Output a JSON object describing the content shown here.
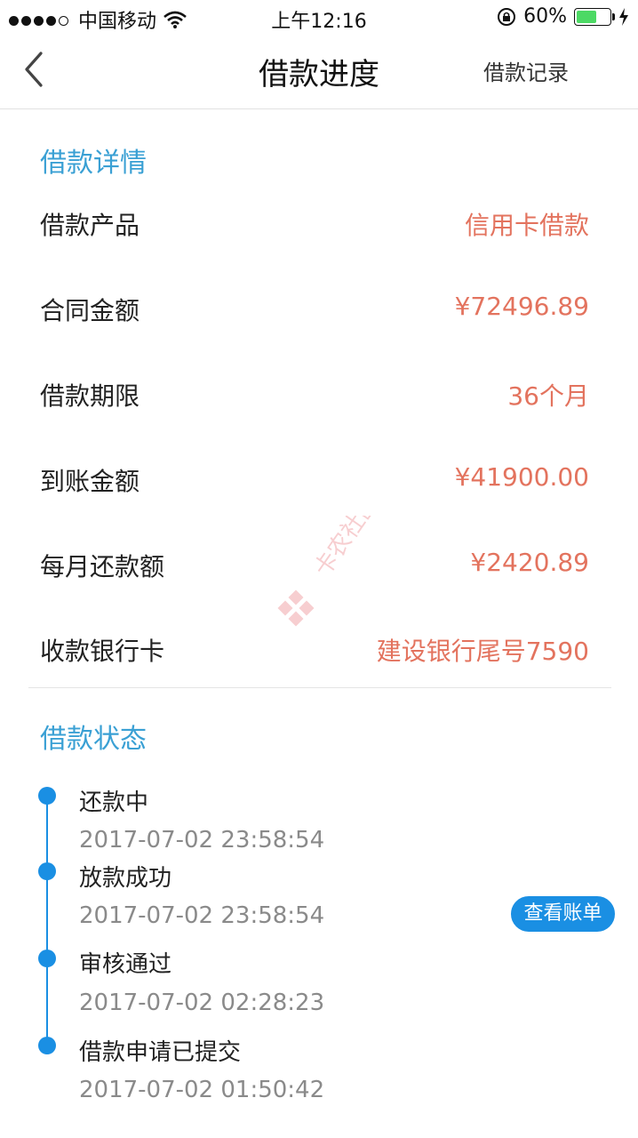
{
  "status_bar": {
    "carrier": "中国移动",
    "time": "上午12:16",
    "battery_percent": "60%",
    "battery_level": 0.6
  },
  "nav": {
    "title": "借款进度",
    "right_link": "借款记录"
  },
  "details": {
    "section_title": "借款详情",
    "rows": [
      {
        "label": "借款产品",
        "value": "信用卡借款"
      },
      {
        "label": "合同金额",
        "value": "¥72496.89"
      },
      {
        "label": "借款期限",
        "value": "36个月"
      },
      {
        "label": "到账金额",
        "value": "¥41900.00"
      },
      {
        "label": "每月还款额",
        "value": "¥2420.89"
      },
      {
        "label": "收款银行卡",
        "value": "建设银行尾号7590"
      }
    ]
  },
  "status": {
    "section_title": "借款状态",
    "steps": [
      {
        "title": "还款中",
        "time": "2017-07-02 23:58:54"
      },
      {
        "title": "放款成功",
        "time": "2017-07-02 23:58:54"
      },
      {
        "title": "审核通过",
        "time": "2017-07-02 02:28:23"
      },
      {
        "title": "借款申请已提交",
        "time": "2017-07-02 01:50:42"
      }
    ],
    "bill_button": "查看账单"
  },
  "watermark": {
    "text": "卡农社区"
  },
  "colors": {
    "accent_blue": "#1a8fe3",
    "section_title": "#3aa0d4",
    "value_text": "#e3735e"
  }
}
